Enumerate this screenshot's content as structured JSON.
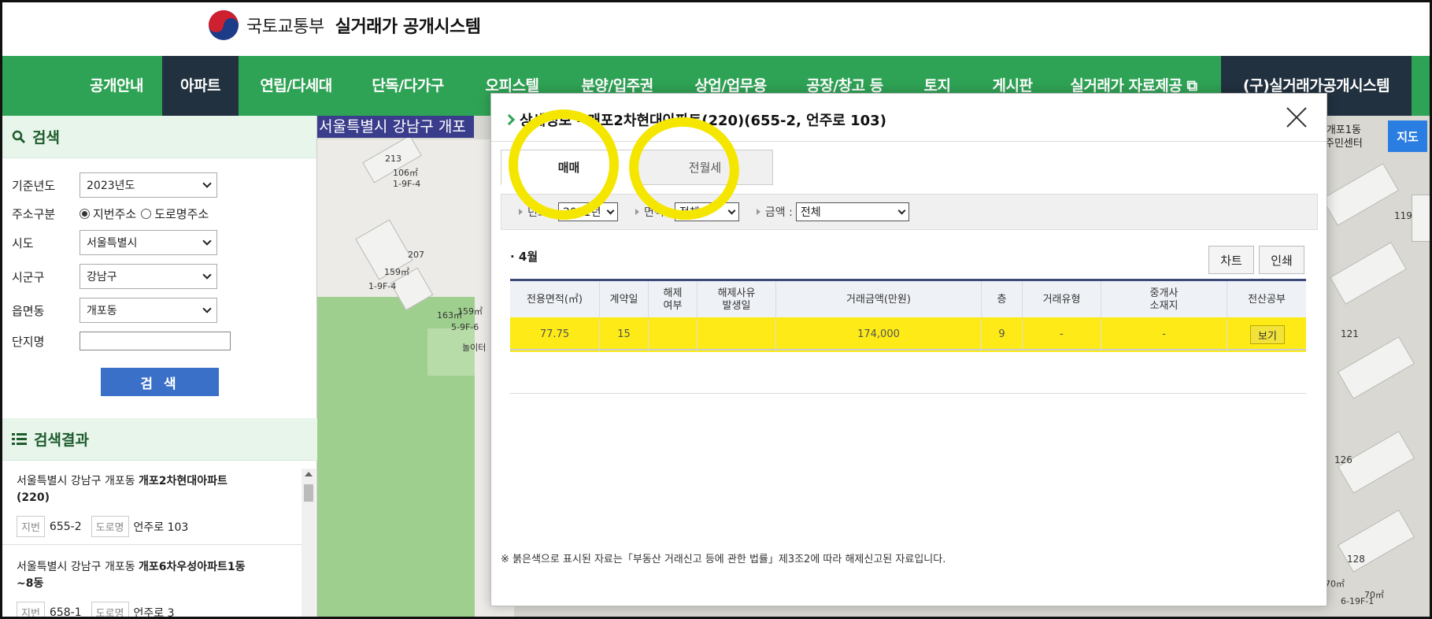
{
  "header": {
    "ministry": "국토교통부",
    "system": "실거래가 공개시스템"
  },
  "nav": [
    {
      "label": "공개안내"
    },
    {
      "label": "아파트"
    },
    {
      "label": "연립/다세대"
    },
    {
      "label": "단독/다가구"
    },
    {
      "label": "오피스텔"
    },
    {
      "label": "분양/입주권"
    },
    {
      "label": "상업/업무용"
    },
    {
      "label": "공장/창고 등"
    },
    {
      "label": "토지"
    },
    {
      "label": "게시판"
    },
    {
      "label": "실거래가 자료제공 ⧉"
    },
    {
      "label": "(구)실거래가공개시스템"
    }
  ],
  "search": {
    "title": "검색",
    "year_label": "기준년도",
    "year_value": "2023년도",
    "addr_type_label": "주소구분",
    "addr_opt1": "지번주소",
    "addr_opt2": "도로명주소",
    "sido_label": "시도",
    "sido_value": "서울특별시",
    "sigungu_label": "시군구",
    "sigungu_value": "강남구",
    "dong_label": "읍면동",
    "dong_value": "개포동",
    "complex_label": "단지명",
    "complex_value": "",
    "button": "검 색"
  },
  "results": {
    "title": "검색결과",
    "items": [
      {
        "addr_prefix": "서울특별시 강남구 개포동",
        "name": "개포2차현대아파트",
        "name_suffix": "(220)",
        "jibun_tag": "지번",
        "jibun": "655-2",
        "road_tag": "도로명",
        "road": "언주로 103"
      },
      {
        "addr_prefix": "서울특별시 강남구 개포동",
        "name": "개포6차우성아파트1동",
        "name_suffix": "~8동",
        "jibun_tag": "지번",
        "jibun": "658-1",
        "road_tag": "도로명",
        "road": "언주로 3"
      }
    ]
  },
  "map": {
    "title": "서울특별시 강남구 개포",
    "map_button": "지도",
    "poi": "개포1동\n주민센터",
    "labels": [
      "213",
      "106㎡",
      "1-9F-4",
      "207",
      "159㎡",
      "1-9F-4",
      "163㎡",
      "159㎡",
      "5-9F-6",
      "놀이터",
      "119",
      "121",
      "126",
      "128",
      "70㎡",
      "70㎡",
      "6-19F-1"
    ]
  },
  "modal": {
    "title": "상세정보 - 개포2차현대아파트(220)(655-2, 언주로 103)",
    "tabs": [
      {
        "label": "매매"
      },
      {
        "label": "전월세"
      }
    ],
    "filters": {
      "year_label": "년도 :",
      "year_value": "2021년",
      "area_label": "면적 :",
      "area_value": "전체",
      "amount_label": "금액 :",
      "amount_value": "전체"
    },
    "month": "· 4월",
    "chart_button": "차트",
    "print_button": "인쇄",
    "columns": [
      "전용면적(㎡)",
      "계약일",
      "해제\n여부",
      "해제사유\n발생일",
      "거래금액(만원)",
      "층",
      "거래유형",
      "중개사\n소재지",
      "전산공부"
    ],
    "row": {
      "area": "77.75",
      "day": "15",
      "cancel": "",
      "cancel_date": "",
      "price": "174,000",
      "floor": "9",
      "trade_type": "-",
      "broker": "-",
      "view": "보기"
    },
    "note": "※ 붉은색으로 표시된 자료는「부동산 거래신고 등에 관한 법률」제3조2에 따라 해제신고된 자료입니다."
  },
  "colors": {
    "nav_green": "#2fa355",
    "nav_active": "#22313f",
    "highlight": "#fde909",
    "button_blue": "#3b70c8"
  }
}
